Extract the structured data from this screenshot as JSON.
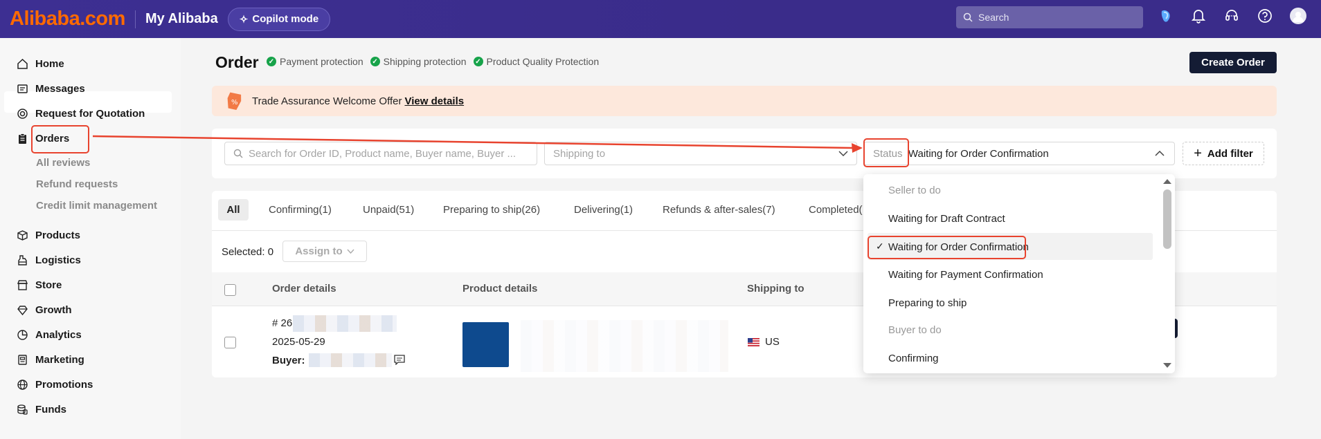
{
  "topbar": {
    "logo": "Alibaba.com",
    "section": "My Alibaba",
    "copilot_label": "Copilot mode",
    "search_placeholder": "Search"
  },
  "sidebar": {
    "items": [
      {
        "label": "Home",
        "icon": "home-icon"
      },
      {
        "label": "Messages",
        "icon": "message-icon"
      },
      {
        "label": "Request for Quotation",
        "icon": "target-icon"
      },
      {
        "label": "Orders",
        "icon": "clipboard-icon"
      },
      {
        "label": "Products",
        "icon": "box-icon"
      },
      {
        "label": "Logistics",
        "icon": "truck-icon"
      },
      {
        "label": "Store",
        "icon": "store-icon"
      },
      {
        "label": "Growth",
        "icon": "growth-icon"
      },
      {
        "label": "Analytics",
        "icon": "analytics-icon"
      },
      {
        "label": "Marketing",
        "icon": "marketing-icon"
      },
      {
        "label": "Promotions",
        "icon": "globe-icon"
      },
      {
        "label": "Funds",
        "icon": "coins-icon"
      }
    ],
    "subitems": [
      "All reviews",
      "Refund requests",
      "Credit limit management"
    ]
  },
  "header": {
    "title": "Order",
    "protections": [
      "Payment protection",
      "Shipping protection",
      "Product Quality Protection"
    ],
    "create_order": "Create Order"
  },
  "banner": {
    "text": "Trade Assurance Welcome Offer",
    "link": "View details"
  },
  "filters": {
    "search_placeholder": "Search for Order ID, Product name, Buyer name, Buyer ...",
    "shipping_placeholder": "Shipping to",
    "status_label": "Status",
    "status_value": "Waiting for Order Confirmation",
    "add_filter": "Add filter"
  },
  "tabs": [
    "All",
    "Confirming(1)",
    "Unpaid(51)",
    "Preparing to ship(26)",
    "Delivering(1)",
    "Refunds & after-sales(7)",
    "Completed("
  ],
  "toolbar": {
    "selected": "Selected: 0",
    "assign_to": "Assign to"
  },
  "table": {
    "headers": [
      "Order details",
      "Product details",
      "Shipping to"
    ],
    "row": {
      "order_id_prefix": "# 26",
      "date": "2025-05-29",
      "buyer_label": "Buyer:",
      "shipping_to": "US"
    }
  },
  "dropdown": {
    "items": [
      {
        "label": "Seller to do",
        "group": true
      },
      {
        "label": "Waiting for Draft Contract",
        "group": false
      },
      {
        "label": "Waiting for Order Confirmation",
        "group": false,
        "selected": true
      },
      {
        "label": "Waiting for Payment Confirmation",
        "group": false
      },
      {
        "label": "Preparing to ship",
        "group": false
      },
      {
        "label": "Buyer to do",
        "group": true
      },
      {
        "label": "Confirming",
        "group": false
      }
    ]
  },
  "colors": {
    "topbar": "#3a2c8a",
    "brand_orange": "#ff6a00",
    "annotation": "#e8432e",
    "success_green": "#17a34a"
  }
}
